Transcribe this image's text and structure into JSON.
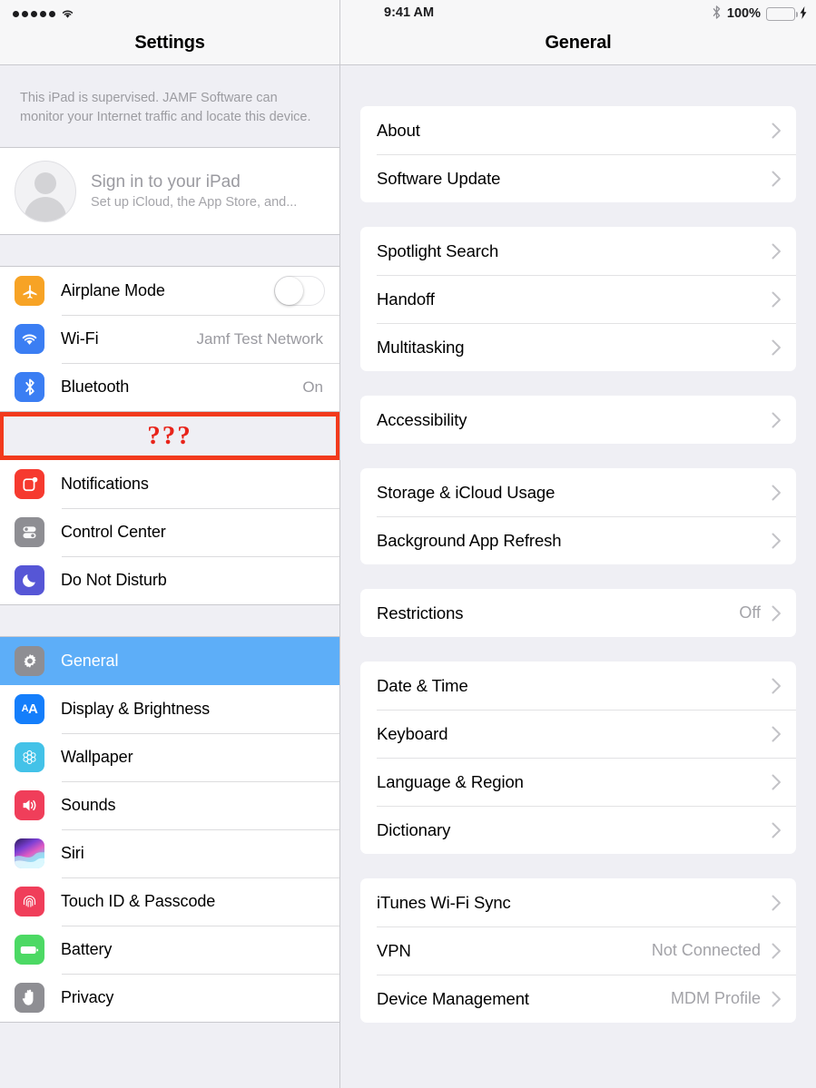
{
  "sidebar": {
    "status": {
      "signal_dots": 5,
      "wifi_icon": "wifi-icon"
    },
    "title": "Settings",
    "supervision_notice": "This iPad is supervised. JAMF Software can monitor your Internet traffic and locate this device.",
    "signin": {
      "title": "Sign in to your iPad",
      "subtitle": "Set up iCloud, the App Store, and..."
    },
    "group_connectivity": [
      {
        "label": "Airplane Mode",
        "icon": "airplane-icon",
        "icon_color": "#F7A325",
        "glyph": "✈",
        "control": "toggle",
        "toggle_on": false
      },
      {
        "label": "Wi-Fi",
        "icon": "wifi-icon",
        "icon_color": "#3B7EF3",
        "glyph": "▾",
        "value": "Jamf Test Network"
      },
      {
        "label": "Bluetooth",
        "icon": "bluetooth-icon",
        "icon_color": "#3B7EF3",
        "glyph": "ᛦ",
        "value": "On"
      }
    ],
    "highlighted_row": {
      "label": "???",
      "outline_color": "#F23A1C",
      "text_color": "#E8241A"
    },
    "group_alerts": [
      {
        "label": "Notifications",
        "icon": "notifications-icon",
        "icon_color": "#F63A2F",
        "glyph": "▢"
      },
      {
        "label": "Control Center",
        "icon": "control-center-icon",
        "icon_color": "#8E8E93",
        "glyph": "☰"
      },
      {
        "label": "Do Not Disturb",
        "icon": "do-not-disturb-icon",
        "icon_color": "#5656D6",
        "glyph": "☾"
      }
    ],
    "group_system": [
      {
        "label": "General",
        "icon": "gear-icon",
        "icon_color": "#8E8E93",
        "glyph": "⚙",
        "selected": true
      },
      {
        "label": "Display & Brightness",
        "icon": "display-brightness-icon",
        "icon_color": "#147EFB",
        "glyph": "AA"
      },
      {
        "label": "Wallpaper",
        "icon": "wallpaper-icon",
        "icon_color": "#43C2E8",
        "glyph": "❀"
      },
      {
        "label": "Sounds",
        "icon": "sounds-icon",
        "icon_color": "#F03E5A",
        "glyph": "🔊"
      },
      {
        "label": "Siri",
        "icon": "siri-icon",
        "icon_color": "#5A4FCF",
        "glyph": ""
      },
      {
        "label": "Touch ID & Passcode",
        "icon": "touch-id-icon",
        "icon_color": "#F03E5A",
        "glyph": "◎"
      },
      {
        "label": "Battery",
        "icon": "battery-icon",
        "icon_color": "#4CD964",
        "glyph": "▬"
      },
      {
        "label": "Privacy",
        "icon": "privacy-hand-icon",
        "icon_color": "#8E8E93",
        "glyph": "✋"
      }
    ],
    "selected_item": "General"
  },
  "detail": {
    "status": {
      "time": "9:41 AM",
      "bluetooth_icon": "bluetooth-icon",
      "battery_percent": "100%",
      "battery_color": "#4CD964",
      "charging_icon": "lightning-bolt-icon"
    },
    "title": "General",
    "groups": [
      {
        "rows": [
          {
            "label": "About",
            "value": "",
            "chevron": true
          },
          {
            "label": "Software Update",
            "value": "",
            "chevron": true
          }
        ]
      },
      {
        "rows": [
          {
            "label": "Spotlight Search",
            "value": "",
            "chevron": true
          },
          {
            "label": "Handoff",
            "value": "",
            "chevron": true
          },
          {
            "label": "Multitasking",
            "value": "",
            "chevron": true
          }
        ]
      },
      {
        "rows": [
          {
            "label": "Accessibility",
            "value": "",
            "chevron": true
          }
        ]
      },
      {
        "rows": [
          {
            "label": "Storage & iCloud Usage",
            "value": "",
            "chevron": true
          },
          {
            "label": "Background App Refresh",
            "value": "",
            "chevron": true
          }
        ]
      },
      {
        "rows": [
          {
            "label": "Restrictions",
            "value": "Off",
            "chevron": true
          }
        ]
      },
      {
        "rows": [
          {
            "label": "Date & Time",
            "value": "",
            "chevron": true
          },
          {
            "label": "Keyboard",
            "value": "",
            "chevron": true
          },
          {
            "label": "Language & Region",
            "value": "",
            "chevron": true
          },
          {
            "label": "Dictionary",
            "value": "",
            "chevron": true
          }
        ]
      },
      {
        "rows": [
          {
            "label": "iTunes Wi-Fi Sync",
            "value": "",
            "chevron": true
          },
          {
            "label": "VPN",
            "value": "Not Connected",
            "chevron": true
          },
          {
            "label": "Device Management",
            "value": "MDM Profile",
            "chevron": true
          }
        ]
      }
    ]
  }
}
